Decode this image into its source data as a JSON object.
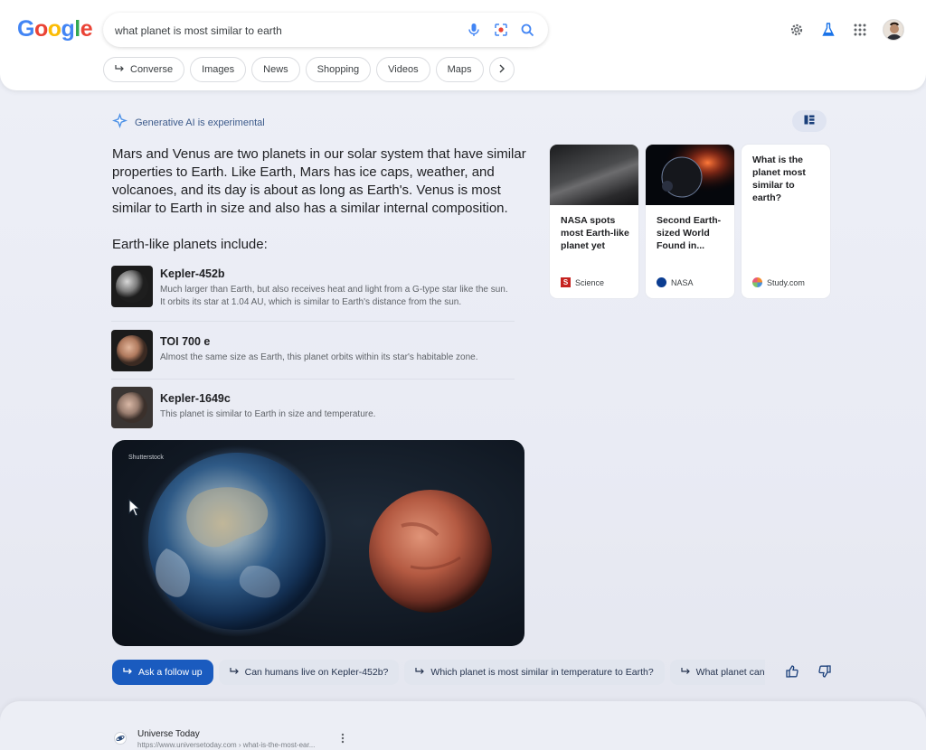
{
  "search": {
    "query": "what planet is most similar to earth"
  },
  "logo": [
    "G",
    "o",
    "o",
    "g",
    "l",
    "e"
  ],
  "chips": [
    {
      "label": "Converse",
      "icon": "arrow-return-icon"
    },
    {
      "label": "Images"
    },
    {
      "label": "News"
    },
    {
      "label": "Shopping"
    },
    {
      "label": "Videos"
    },
    {
      "label": "Maps"
    }
  ],
  "ai": {
    "badge": "Generative AI is experimental",
    "summary": "Mars and Venus are two planets in our solar system that have similar properties to Earth. Like Earth, Mars has ice caps, weather, and volcanoes, and its day is about as long as Earth's. Venus is most similar to Earth in size and also has a similar internal composition.",
    "subhead": "Earth-like planets include:",
    "planets": [
      {
        "name": "Kepler-452b",
        "desc": "Much larger than Earth, but also receives heat and light from a G-type star like the sun. It orbits its star at 1.04 AU, which is similar to Earth's distance from the sun."
      },
      {
        "name": "TOI 700 e",
        "desc": "Almost the same size as Earth, this planet orbits within its star's habitable zone."
      },
      {
        "name": "Kepler-1649c",
        "desc": "This planet is similar to Earth in size and temperature."
      }
    ],
    "hero_credit": "Shutterstock"
  },
  "cards": [
    {
      "title": "NASA spots most Earth-like planet yet",
      "source": "Science"
    },
    {
      "title": "Second Earth-sized World Found in...",
      "source": "NASA"
    },
    {
      "title": "What is the planet most similar to earth?",
      "source": "Study.com"
    }
  ],
  "followups": {
    "primary": "Ask a follow up",
    "items": [
      "Can humans live on Kepler-452b?",
      "Which planet is most similar in temperature to Earth?",
      "What planet can we"
    ]
  },
  "result": {
    "site": "Universe Today",
    "url": "https://www.universetoday.com › what-is-the-most-ear..."
  },
  "colors": {
    "accent": "#1a5bbf",
    "page_bg": "#eceef6"
  }
}
